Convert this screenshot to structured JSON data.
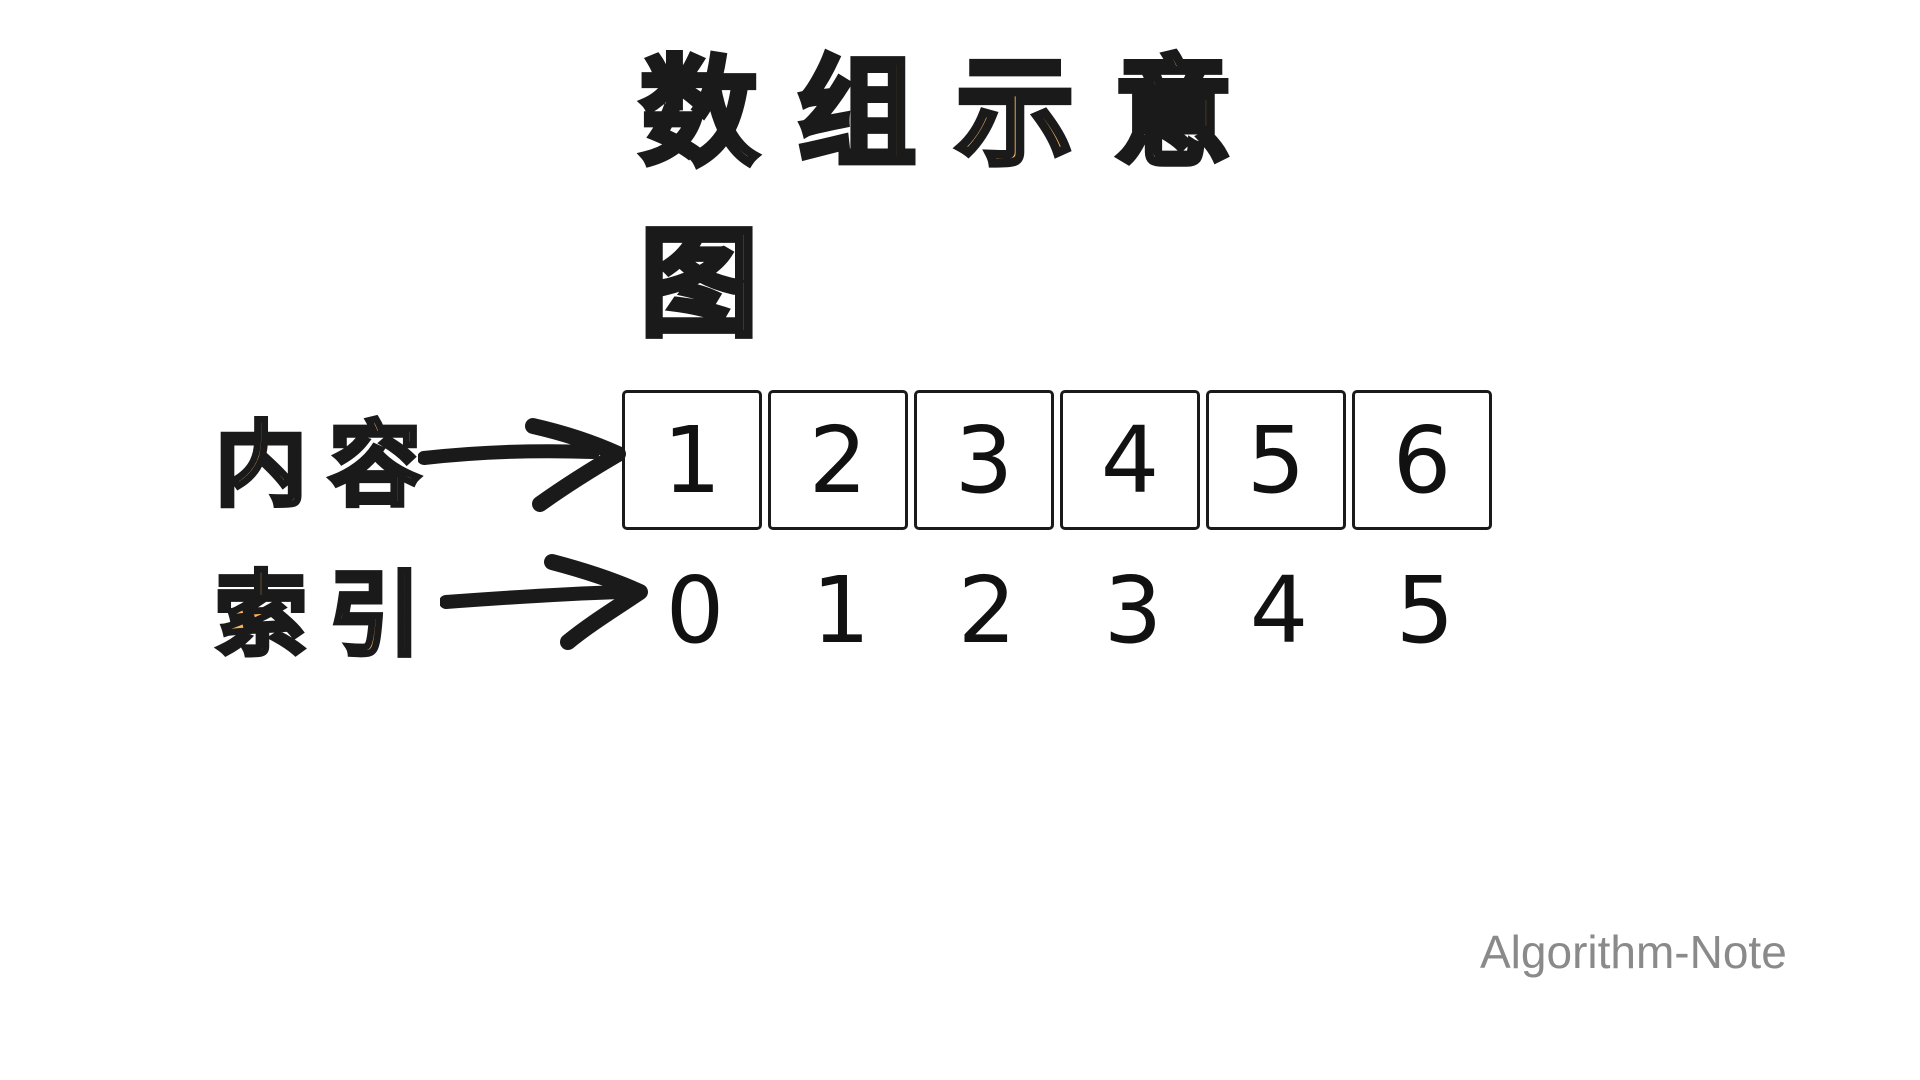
{
  "title": "数组示意图",
  "labels": {
    "content": "内容",
    "index": "索引"
  },
  "array": {
    "values": [
      "1",
      "2",
      "3",
      "4",
      "5",
      "6"
    ],
    "indices": [
      "0",
      "1",
      "2",
      "3",
      "4",
      "5"
    ]
  },
  "watermark": "Algorithm-Note",
  "colors": {
    "accent": "#FFB45E",
    "ink": "#1a1a1a",
    "watermark": "#8a8a8a"
  },
  "icons": {
    "content_arrow": "right-arrow-icon",
    "index_arrow": "right-arrow-icon"
  }
}
